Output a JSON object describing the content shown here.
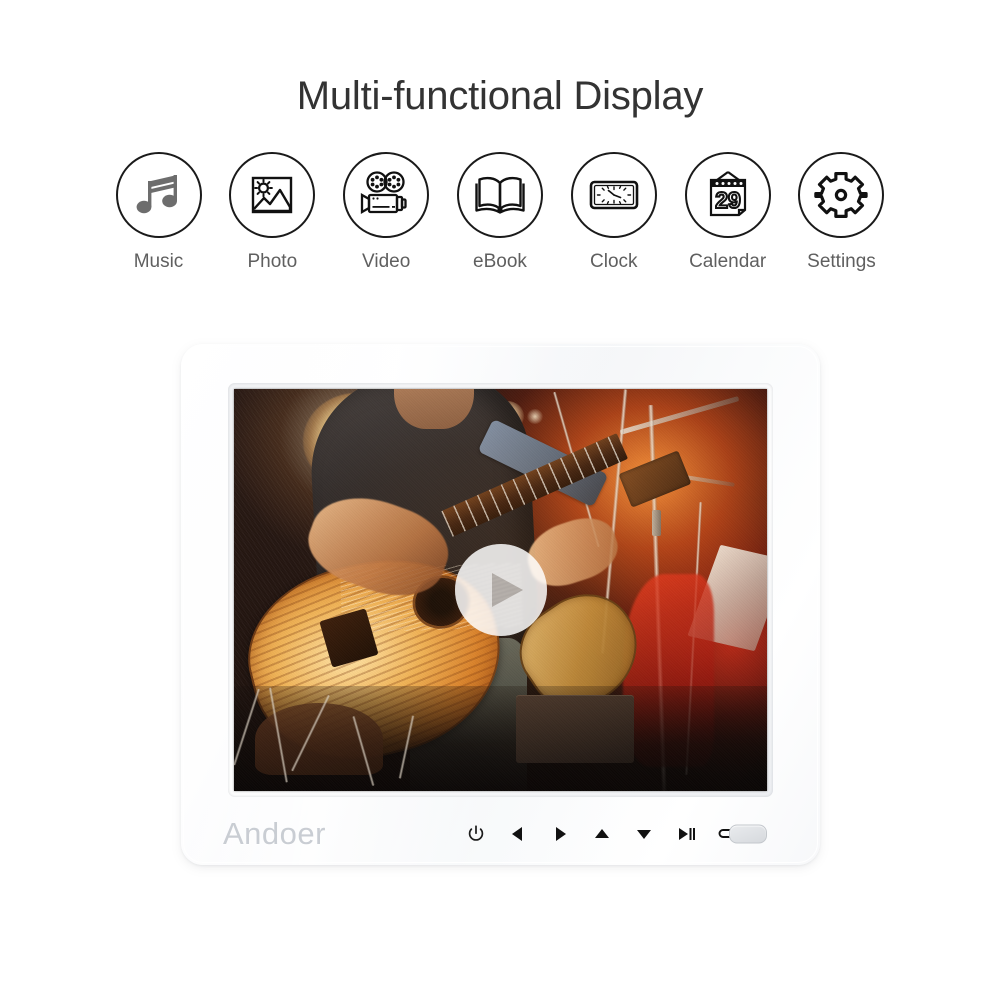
{
  "header": {
    "title": "Multi-functional Display"
  },
  "features": [
    {
      "label": "Music",
      "icon": "music-note-icon"
    },
    {
      "label": "Photo",
      "icon": "photo-image-icon"
    },
    {
      "label": "Video",
      "icon": "movie-camera-icon"
    },
    {
      "label": "eBook",
      "icon": "open-book-icon"
    },
    {
      "label": "Clock",
      "icon": "clock-icon"
    },
    {
      "label": "Calendar",
      "icon": "calendar-icon"
    },
    {
      "label": "Settings",
      "icon": "gear-icon"
    }
  ],
  "device": {
    "brand": "Andoer",
    "frame_color": "#fafbfc",
    "screen": {
      "media_type": "photo",
      "overlay_icon": "play-button-icon",
      "scene_description": "Guitarist performing on stage with acoustic guitar under warm stage lights"
    },
    "controls": [
      {
        "name": "power-button",
        "glyph": "power-icon"
      },
      {
        "name": "left-button",
        "glyph": "triangle-left-icon"
      },
      {
        "name": "right-button",
        "glyph": "triangle-right-icon"
      },
      {
        "name": "up-button",
        "glyph": "triangle-up-icon"
      },
      {
        "name": "down-button",
        "glyph": "triangle-down-icon"
      },
      {
        "name": "play-pause-button",
        "glyph": "play-pause-icon"
      },
      {
        "name": "return-button",
        "glyph": "return-arrow-icon"
      }
    ],
    "ir_window": {
      "name": "ir-sensor-window"
    }
  },
  "colors": {
    "title_text": "#333333",
    "label_text": "#5f5f5f",
    "icon_stroke": "#1a1a1a",
    "brand_text": "#c9cdd3",
    "background": "#ffffff"
  }
}
